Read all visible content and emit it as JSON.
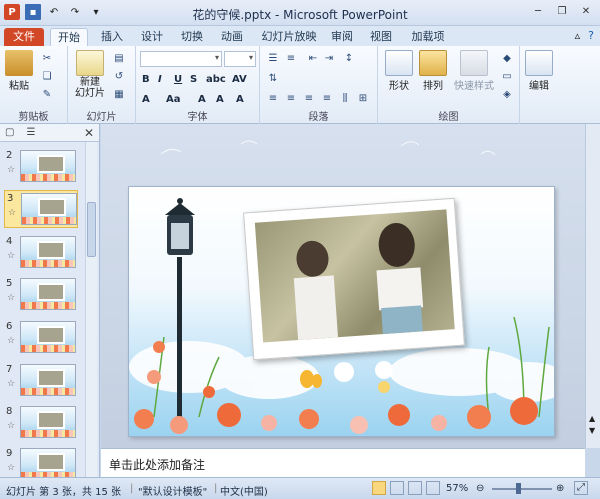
{
  "window": {
    "title": "花的守候.pptx - Microsoft PowerPoint"
  },
  "tabs": [
    "文件",
    "开始",
    "插入",
    "设计",
    "切换",
    "动画",
    "幻灯片放映",
    "审阅",
    "视图",
    "加载项"
  ],
  "ribbon": {
    "groups": {
      "clipboard": "剪贴板",
      "slides": "幻灯片",
      "font": "字体",
      "paragraph": "段落",
      "drawing": "绘图"
    },
    "paste_label": "粘贴",
    "new_slide_label": "新建\n幻灯片",
    "shapes_label": "形状",
    "arrange_label": "排列",
    "quick_styles_label": "快速样式",
    "edit_label": "编辑"
  },
  "thumbnails": [
    {
      "num": "2",
      "star": "☆"
    },
    {
      "num": "3",
      "star": "☆"
    },
    {
      "num": "4",
      "star": "☆"
    },
    {
      "num": "5",
      "star": "☆"
    },
    {
      "num": "6",
      "star": "☆"
    },
    {
      "num": "7",
      "star": "☆"
    },
    {
      "num": "8",
      "star": "☆"
    },
    {
      "num": "9",
      "star": "☆"
    }
  ],
  "notes": {
    "placeholder": "单击此处添加备注"
  },
  "status": {
    "slide_info": "幻灯片 第 3 张，共 15 张",
    "theme": "\"默认设计模板\"",
    "language": "中文(中国)",
    "zoom": "57%"
  },
  "colors": {
    "file_tab": "#d24726",
    "selected_thumb": "#fbe79d"
  }
}
